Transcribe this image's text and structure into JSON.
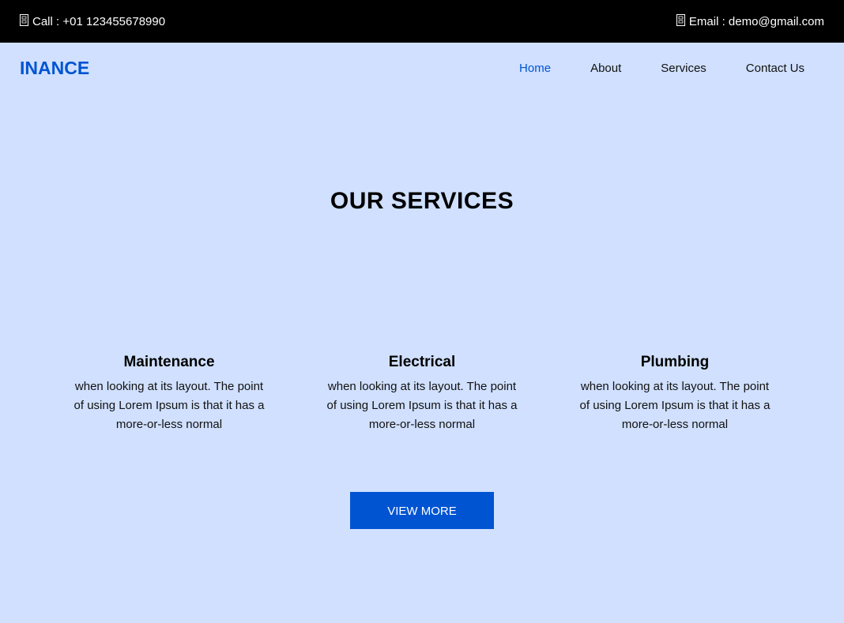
{
  "topbar": {
    "call_icon": "phone-icon",
    "call_text": "Call : +01 123455678990",
    "email_icon": "envelope-icon",
    "email_text": "Email : demo@gmail.com"
  },
  "header": {
    "brand": "INANCE",
    "nav": [
      {
        "label": "Home",
        "active": true
      },
      {
        "label": "About",
        "active": false
      },
      {
        "label": "Services",
        "active": false
      },
      {
        "label": "Contact Us",
        "active": false
      }
    ]
  },
  "services": {
    "title": "OUR SERVICES",
    "items": [
      {
        "name": "Maintenance",
        "text": "when looking at its layout. The point of using Lorem Ipsum is that it has a more-or-less normal"
      },
      {
        "name": "Electrical",
        "text": "when looking at its layout. The point of using Lorem Ipsum is that it has a more-or-less normal"
      },
      {
        "name": "Plumbing",
        "text": "when looking at its layout. The point of using Lorem Ipsum is that it has a more-or-less normal"
      }
    ],
    "button": "VIEW MORE"
  },
  "colors": {
    "accent": "#0054d2",
    "background": "#d0e0fe",
    "topbar": "#000000"
  }
}
